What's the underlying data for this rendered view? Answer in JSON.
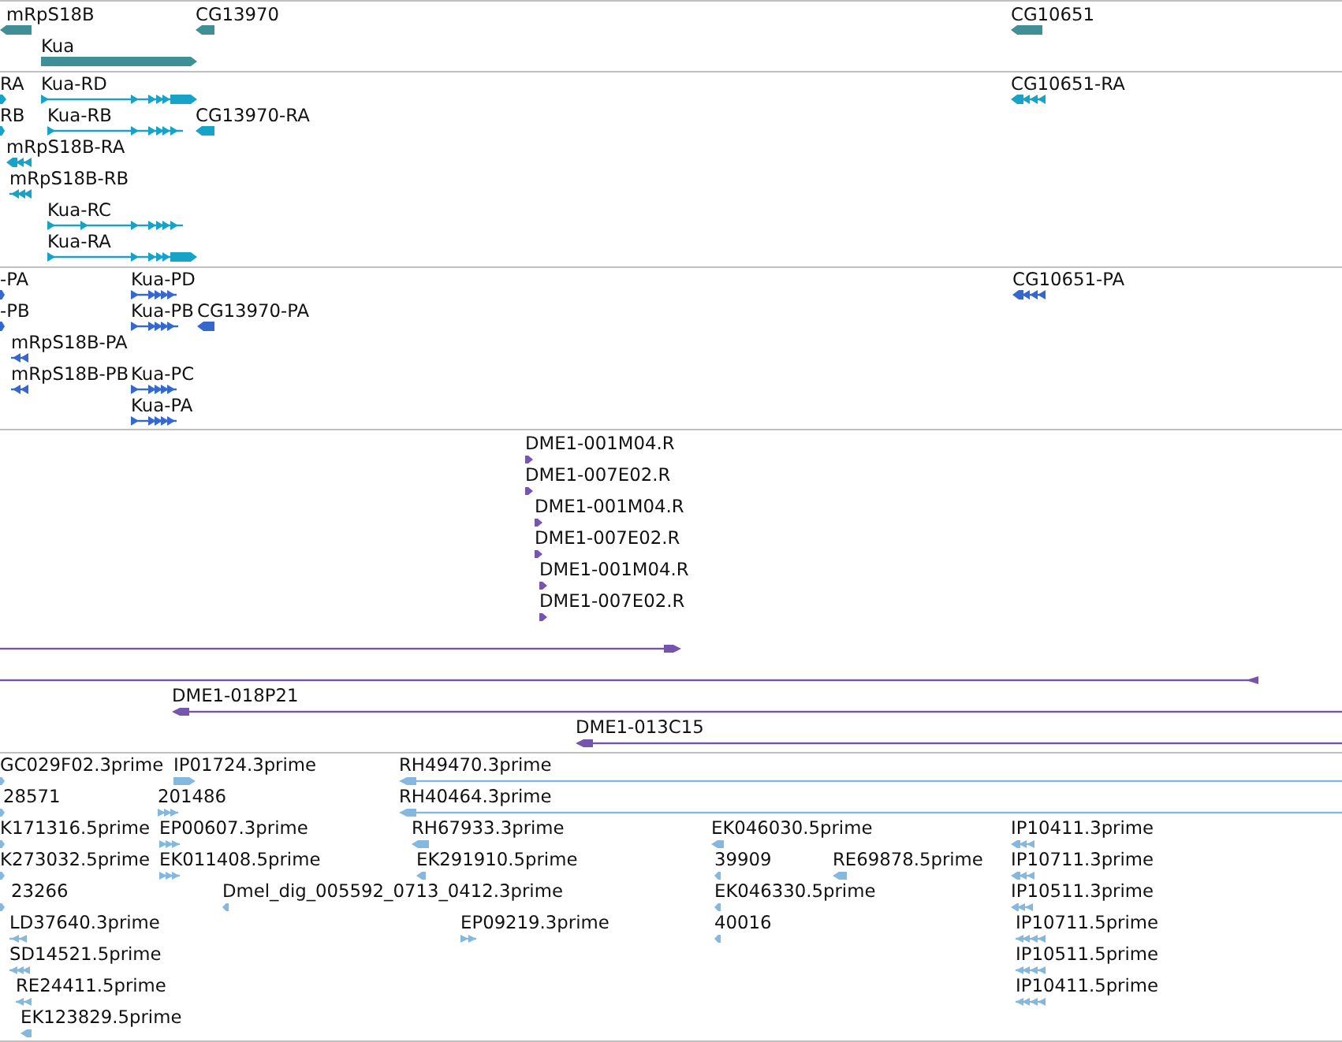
{
  "tracks": [
    {
      "color": "#3f8f96",
      "features": [
        {
          "label": "mRpS18B",
          "kind": "block",
          "reverse": true
        },
        {
          "label": "CG13970",
          "kind": "block",
          "reverse": true
        },
        {
          "label": "CG10651",
          "kind": "block",
          "reverse": true
        },
        {
          "label": "Kua",
          "kind": "block",
          "reverse": false
        }
      ]
    },
    {
      "color": "#17a2c7",
      "features": [
        {
          "label": "RA",
          "kind": "block",
          "reverse": false
        },
        {
          "label": "Kua-RD",
          "kind": "exons",
          "reverse": false
        },
        {
          "label": "CG10651-RA",
          "kind": "exons",
          "reverse": true
        },
        {
          "label": "RB",
          "kind": "block",
          "reverse": false
        },
        {
          "label": "Kua-RB",
          "kind": "exons",
          "reverse": false
        },
        {
          "label": "CG13970-RA",
          "kind": "block",
          "reverse": true
        },
        {
          "label": "mRpS18B-RA",
          "kind": "exons",
          "reverse": true
        },
        {
          "label": "mRpS18B-RB",
          "kind": "exons",
          "reverse": true
        },
        {
          "label": "Kua-RC",
          "kind": "exons",
          "reverse": false
        },
        {
          "label": "Kua-RA",
          "kind": "exons",
          "reverse": false
        }
      ]
    },
    {
      "color": "#3468cf",
      "features": [
        {
          "label": "-PA",
          "kind": "block",
          "reverse": false
        },
        {
          "label": "Kua-PD",
          "kind": "exons",
          "reverse": false
        },
        {
          "label": "CG10651-PA",
          "kind": "exons",
          "reverse": true
        },
        {
          "label": "-PB",
          "kind": "block",
          "reverse": false
        },
        {
          "label": "Kua-PB",
          "kind": "exons",
          "reverse": false
        },
        {
          "label": "CG13970-PA",
          "kind": "block",
          "reverse": true
        },
        {
          "label": "mRpS18B-PA",
          "kind": "exons",
          "reverse": true
        },
        {
          "label": "mRpS18B-PB",
          "kind": "exons",
          "reverse": true
        },
        {
          "label": "Kua-PC",
          "kind": "exons",
          "reverse": false
        },
        {
          "label": "Kua-PA",
          "kind": "exons",
          "reverse": false
        }
      ]
    },
    {
      "color": "#7656ad",
      "features": [
        {
          "label": "DME1-001M04.R",
          "kind": "block",
          "reverse": false
        },
        {
          "label": "DME1-007E02.R",
          "kind": "block",
          "reverse": false
        },
        {
          "label": "DME1-001M04.R",
          "kind": "block",
          "reverse": false
        },
        {
          "label": "DME1-007E02.R",
          "kind": "block",
          "reverse": false
        },
        {
          "label": "DME1-001M04.R",
          "kind": "block",
          "reverse": false
        },
        {
          "label": "DME1-007E02.R",
          "kind": "block",
          "reverse": false
        },
        {
          "kind": "line",
          "reverse": false
        },
        {
          "kind": "line",
          "reverse": true
        },
        {
          "label": "DME1-018P21",
          "kind": "line",
          "reverse": true
        },
        {
          "label": "DME1-013C15",
          "kind": "line",
          "reverse": true
        }
      ]
    },
    {
      "color": "#84b8df",
      "features": [
        {
          "label": "GC029F02.3prime",
          "kind": "block",
          "reverse": false
        },
        {
          "label": "IP01724.3prime",
          "kind": "block",
          "reverse": false
        },
        {
          "label": "RH49470.3prime",
          "kind": "line",
          "reverse": true
        },
        {
          "label": "28571",
          "kind": "block",
          "reverse": false
        },
        {
          "label": "201486",
          "kind": "exons",
          "reverse": false
        },
        {
          "label": "RH40464.3prime",
          "kind": "line",
          "reverse": true
        },
        {
          "label": "K171316.5prime",
          "kind": "block",
          "reverse": false
        },
        {
          "label": "EP00607.3prime",
          "kind": "exons",
          "reverse": false
        },
        {
          "label": "RH67933.3prime",
          "kind": "block",
          "reverse": true
        },
        {
          "label": "EK046030.5prime",
          "kind": "block",
          "reverse": true
        },
        {
          "label": "IP10411.3prime",
          "kind": "exons",
          "reverse": true
        },
        {
          "label": "K273032.5prime",
          "kind": "block",
          "reverse": false
        },
        {
          "label": "EK011408.5prime",
          "kind": "exons",
          "reverse": false
        },
        {
          "label": "EK291910.5prime",
          "kind": "block",
          "reverse": true
        },
        {
          "label": "39909",
          "kind": "block",
          "reverse": true
        },
        {
          "label": "RE69878.5prime",
          "kind": "block",
          "reverse": true
        },
        {
          "label": "IP10711.3prime",
          "kind": "exons",
          "reverse": true
        },
        {
          "label": "23266",
          "kind": "block",
          "reverse": false
        },
        {
          "label": "Dmel_dig_005592_0713_0412.3prime",
          "kind": "block",
          "reverse": true
        },
        {
          "label": "EK046330.5prime",
          "kind": "block",
          "reverse": true
        },
        {
          "label": "IP10511.3prime",
          "kind": "exons",
          "reverse": true
        },
        {
          "label": "LD37640.3prime",
          "kind": "exons",
          "reverse": true
        },
        {
          "label": "EP09219.3prime",
          "kind": "exons",
          "reverse": false
        },
        {
          "label": "40016",
          "kind": "block",
          "reverse": true
        },
        {
          "label": "IP10711.5prime",
          "kind": "exons",
          "reverse": true
        },
        {
          "label": "SD14521.5prime",
          "kind": "exons",
          "reverse": true
        },
        {
          "label": "IP10511.5prime",
          "kind": "exons",
          "reverse": true
        },
        {
          "label": "RE24411.5prime",
          "kind": "exons",
          "reverse": true
        },
        {
          "label": "IP10411.5prime",
          "kind": "exons",
          "reverse": true
        },
        {
          "label": "EK123829.5prime",
          "kind": "block",
          "reverse": true
        }
      ]
    }
  ]
}
